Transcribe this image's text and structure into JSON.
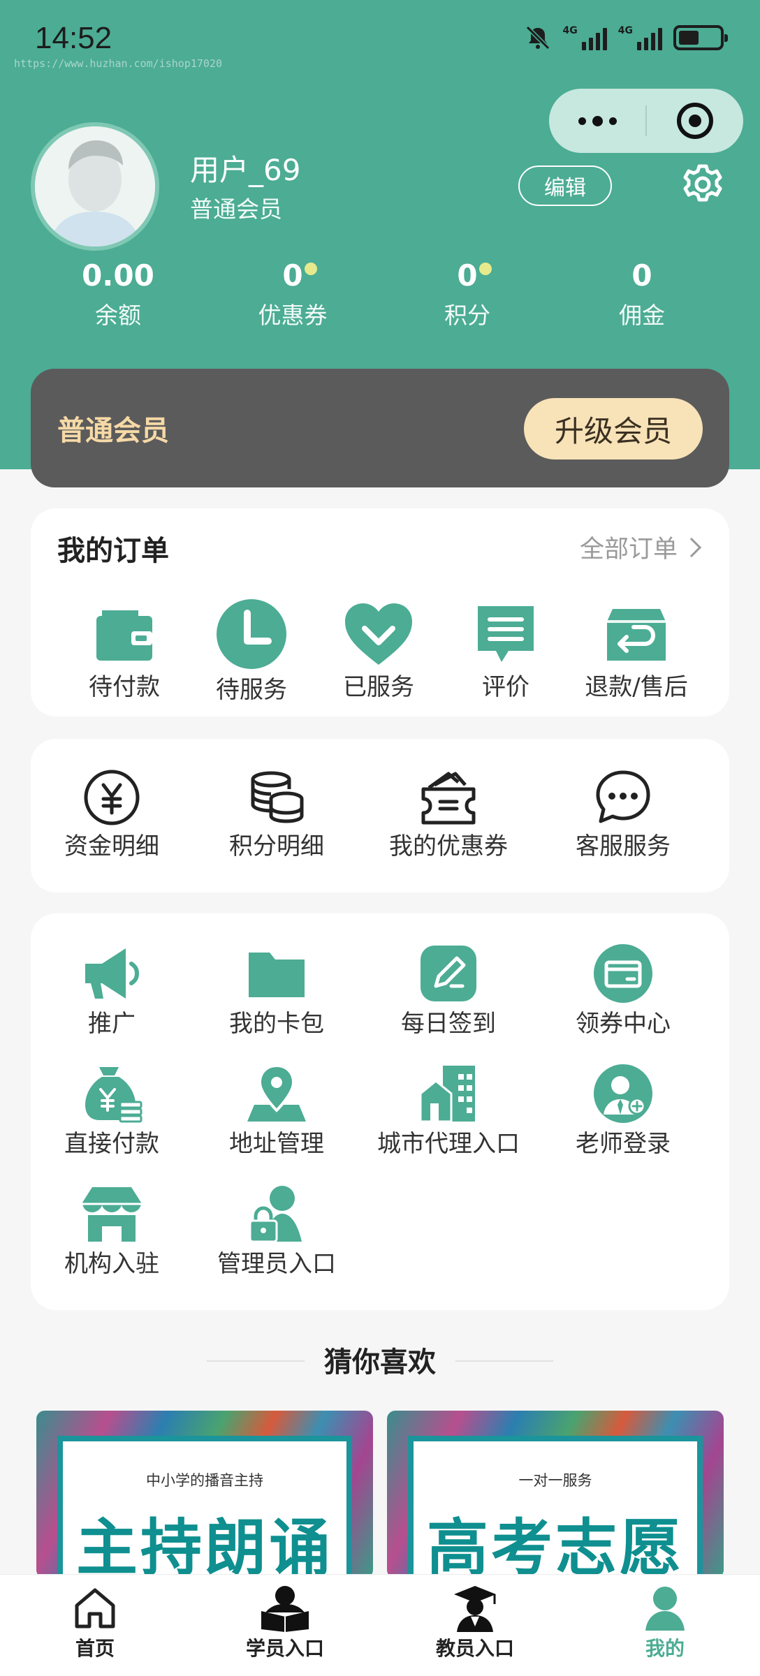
{
  "status_bar": {
    "time": "14:52",
    "watermark": "https://www.huzhan.com/ishop17020",
    "signal1_label": "4G",
    "signal2_label": "4G"
  },
  "capsule": {
    "more_icon": "more-dots-icon",
    "close_icon": "target-close-icon"
  },
  "profile": {
    "username": "用户_69",
    "level": "普通会员",
    "edit_label": "编辑",
    "settings_icon": "gear-icon"
  },
  "stats": [
    {
      "value": "0.00",
      "label": "余额"
    },
    {
      "value": "0",
      "label": "优惠券"
    },
    {
      "value": "0",
      "label": "积分"
    },
    {
      "value": "0",
      "label": "佣金"
    }
  ],
  "member_card": {
    "title": "普通会员",
    "upgrade_label": "升级会员"
  },
  "orders": {
    "title": "我的订单",
    "all_label": "全部订单",
    "items": [
      {
        "label": "待付款",
        "icon": "wallet-icon"
      },
      {
        "label": "待服务",
        "icon": "clock-icon"
      },
      {
        "label": "已服务",
        "icon": "heart-check-icon"
      },
      {
        "label": "评价",
        "icon": "comment-icon"
      },
      {
        "label": "退款/售后",
        "icon": "refund-box-icon"
      }
    ]
  },
  "funds": {
    "items": [
      {
        "label": "资金明细",
        "icon": "yen-circle-icon"
      },
      {
        "label": "积分明细",
        "icon": "coins-stack-icon"
      },
      {
        "label": "我的优惠券",
        "icon": "coupon-icon"
      },
      {
        "label": "客服服务",
        "icon": "chat-bubble-icon"
      }
    ]
  },
  "tools": {
    "items": [
      {
        "label": "推广",
        "icon": "megaphone-icon"
      },
      {
        "label": "我的卡包",
        "icon": "folder-icon"
      },
      {
        "label": "每日签到",
        "icon": "edit-sign-icon"
      },
      {
        "label": "领券中心",
        "icon": "card-icon"
      },
      {
        "label": "直接付款",
        "icon": "money-bag-icon"
      },
      {
        "label": "地址管理",
        "icon": "location-pin-icon"
      },
      {
        "label": "城市代理入口",
        "icon": "city-building-icon"
      },
      {
        "label": "老师登录",
        "icon": "teacher-icon"
      },
      {
        "label": "机构入驻",
        "icon": "store-icon"
      },
      {
        "label": "管理员入口",
        "icon": "admin-lock-icon"
      }
    ]
  },
  "guess": {
    "title": "猜你喜欢"
  },
  "promos": [
    {
      "subtitle": "中小学的播音主持",
      "title": "主持朗诵"
    },
    {
      "subtitle": "一对一服务",
      "title": "高考志愿"
    }
  ],
  "tabbar": [
    {
      "label": "首页",
      "icon": "home-icon",
      "active": false
    },
    {
      "label": "学员入口",
      "icon": "student-reading-icon",
      "active": false
    },
    {
      "label": "教员入口",
      "icon": "graduate-icon",
      "active": false
    },
    {
      "label": "我的",
      "icon": "user-icon",
      "active": true
    }
  ],
  "colors": {
    "primary": "#4cac94",
    "member_card_bg": "#5b5b5b",
    "gold_text": "#f6d9a6",
    "upgrade_bg": "#f8e2b8",
    "badge_dot": "#e6ea8d"
  }
}
